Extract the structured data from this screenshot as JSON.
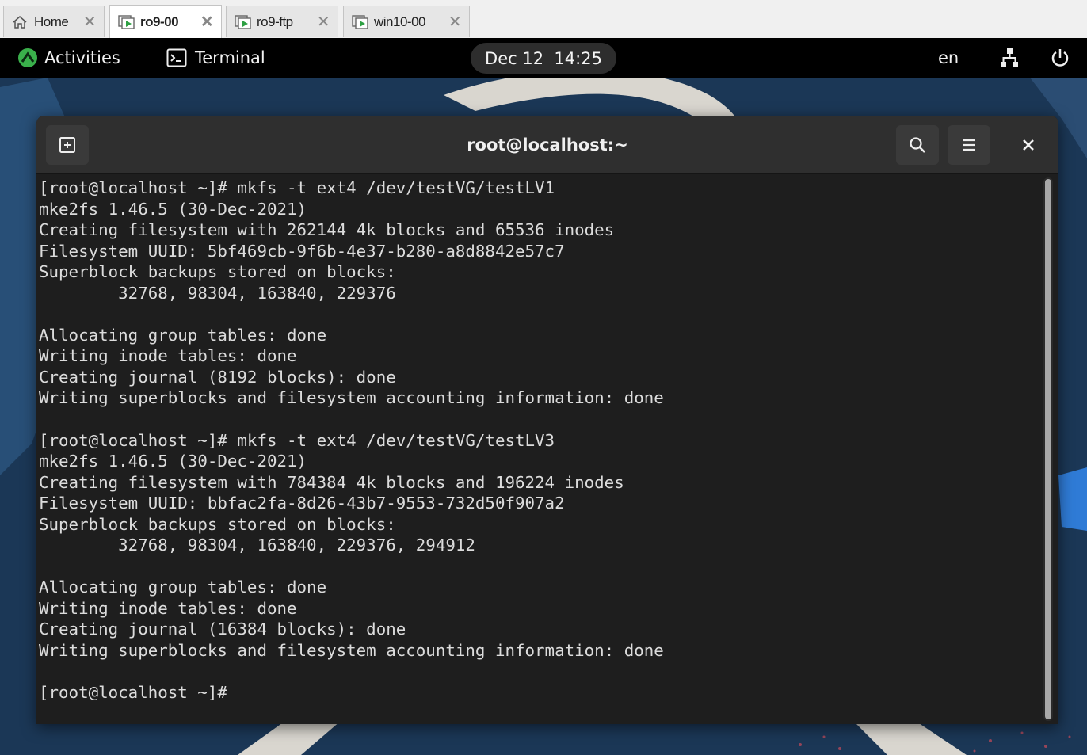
{
  "tabs": [
    {
      "label": "Home",
      "icon": "home-icon",
      "active": false
    },
    {
      "label": "ro9-00",
      "icon": "vm-icon",
      "active": true
    },
    {
      "label": "ro9-ftp",
      "icon": "vm-icon",
      "active": false
    },
    {
      "label": "win10-00",
      "icon": "vm-icon",
      "active": false
    }
  ],
  "topbar": {
    "activities": "Activities",
    "app_name": "Terminal",
    "clock": "Dec 12  14:25",
    "keyboard_layout": "en"
  },
  "window": {
    "title": "root@localhost:~"
  },
  "terminal": {
    "lines": [
      "[root@localhost ~]# mkfs -t ext4 /dev/testVG/testLV1",
      "mke2fs 1.46.5 (30-Dec-2021)",
      "Creating filesystem with 262144 4k blocks and 65536 inodes",
      "Filesystem UUID: 5bf469cb-9f6b-4e37-b280-a8d8842e57c7",
      "Superblock backups stored on blocks:",
      "        32768, 98304, 163840, 229376",
      "",
      "Allocating group tables: done",
      "Writing inode tables: done",
      "Creating journal (8192 blocks): done",
      "Writing superblocks and filesystem accounting information: done",
      "",
      "[root@localhost ~]# mkfs -t ext4 /dev/testVG/testLV3",
      "mke2fs 1.46.5 (30-Dec-2021)",
      "Creating filesystem with 784384 4k blocks and 196224 inodes",
      "Filesystem UUID: bbfac2fa-8d26-43b7-9553-732d50f907a2",
      "Superblock backups stored on blocks:",
      "        32768, 98304, 163840, 229376, 294912",
      "",
      "Allocating group tables: done",
      "Writing inode tables: done",
      "Creating journal (16384 blocks): done",
      "Writing superblocks and filesystem accounting information: done",
      "",
      "[root@localhost ~]# "
    ]
  },
  "colors": {
    "topbar_bg": "#000000",
    "terminal_bg": "#1e1e1e",
    "terminal_fg": "#dcdcdc",
    "headerbar_bg": "#2f2f2f",
    "desktop_bg": "#1a3553",
    "fedora_accent": "#3ab04b"
  }
}
